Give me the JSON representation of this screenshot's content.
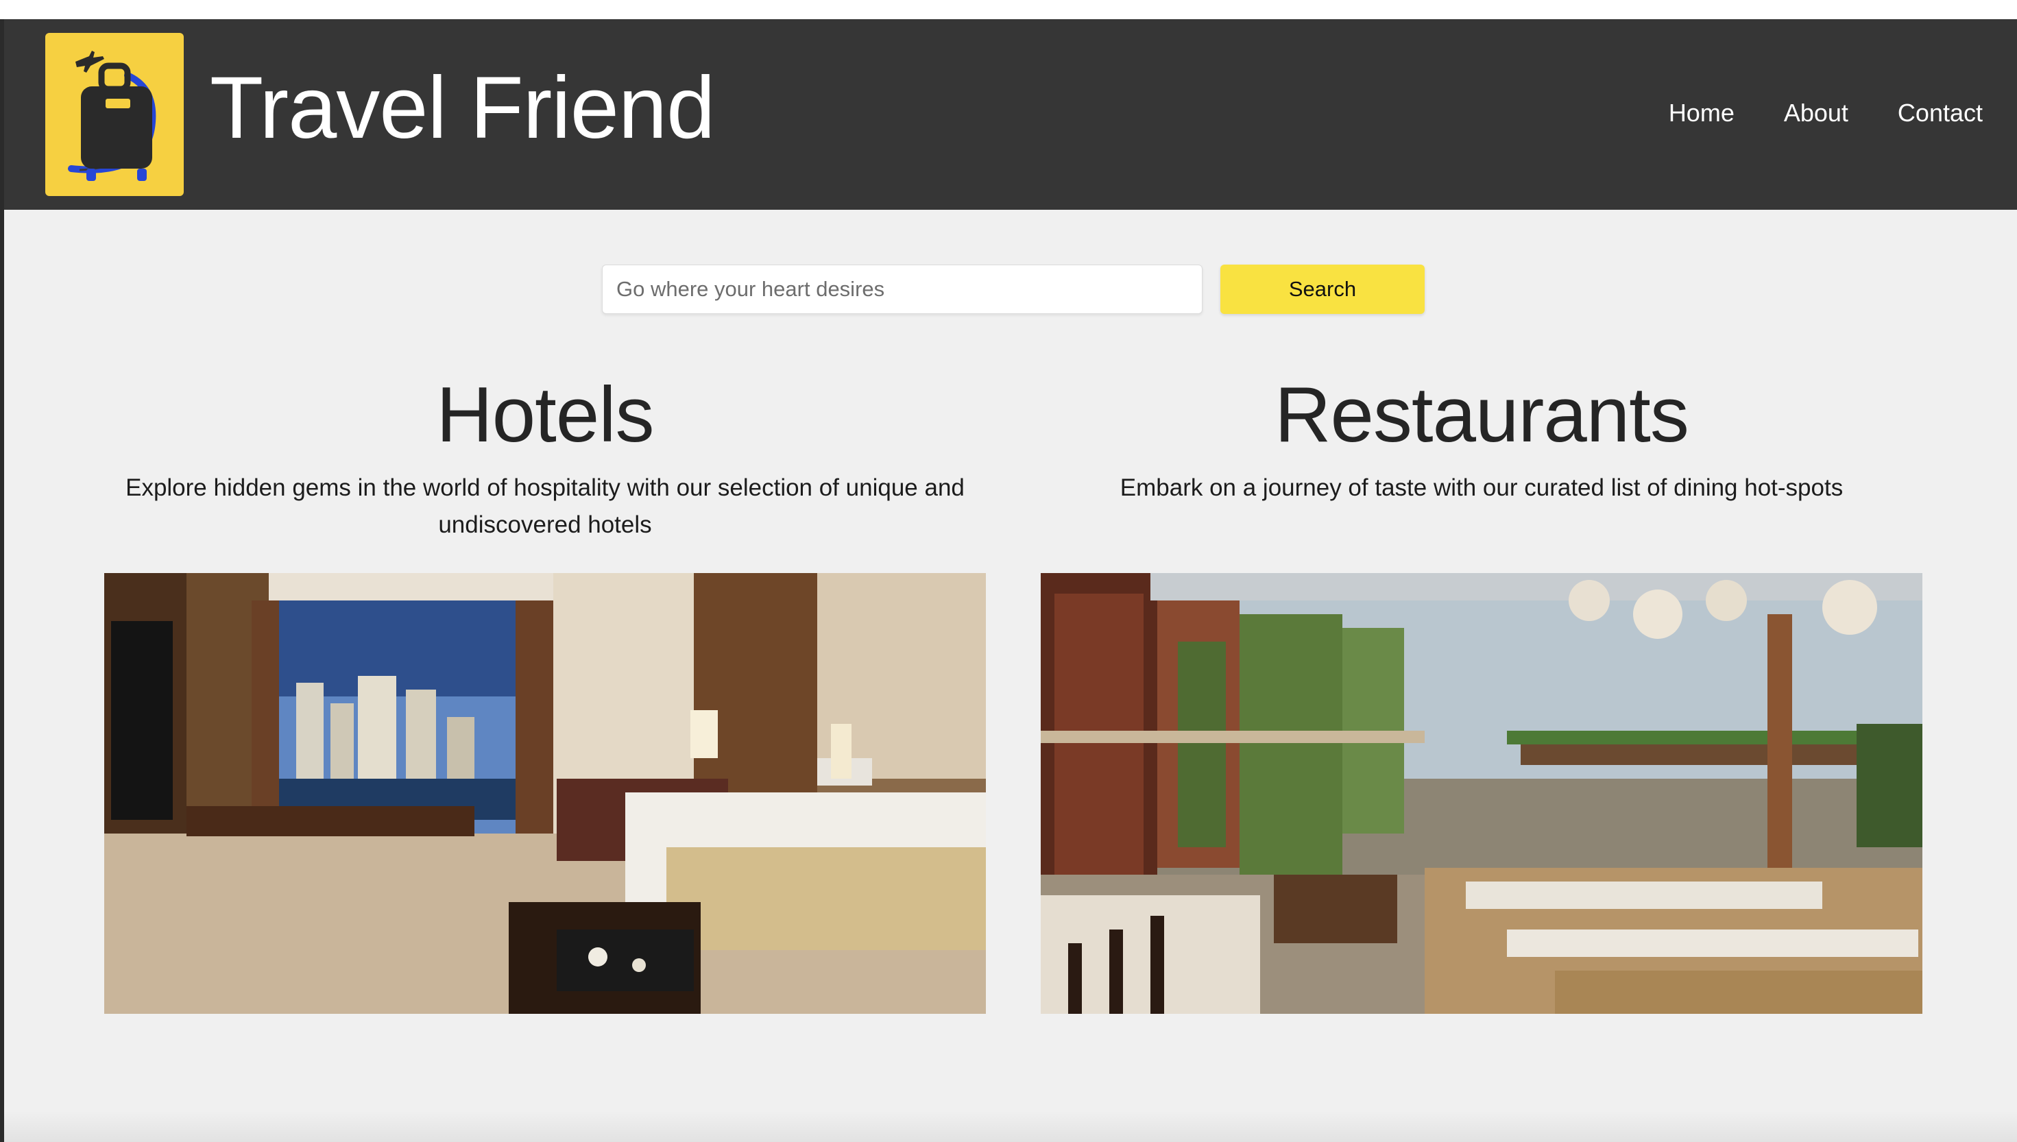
{
  "header": {
    "brand": "Travel Friend",
    "logo_icon": "luggage-airplane-icon",
    "nav": [
      "Home",
      "About",
      "Contact"
    ]
  },
  "search": {
    "placeholder": "Go where your heart desires",
    "button_label": "Search"
  },
  "sections": {
    "hotels": {
      "title": "Hotels",
      "description": "Explore hidden gems in the world of hospitality with our selection of unique and undiscovered hotels"
    },
    "restaurants": {
      "title": "Restaurants",
      "description": "Embark on a journey of taste with our curated list of dining hot-spots"
    }
  },
  "colors": {
    "header_bg": "#363636",
    "logo_bg": "#f6d041",
    "search_button": "#f9e241",
    "page_bg": "#f0f0f0"
  }
}
